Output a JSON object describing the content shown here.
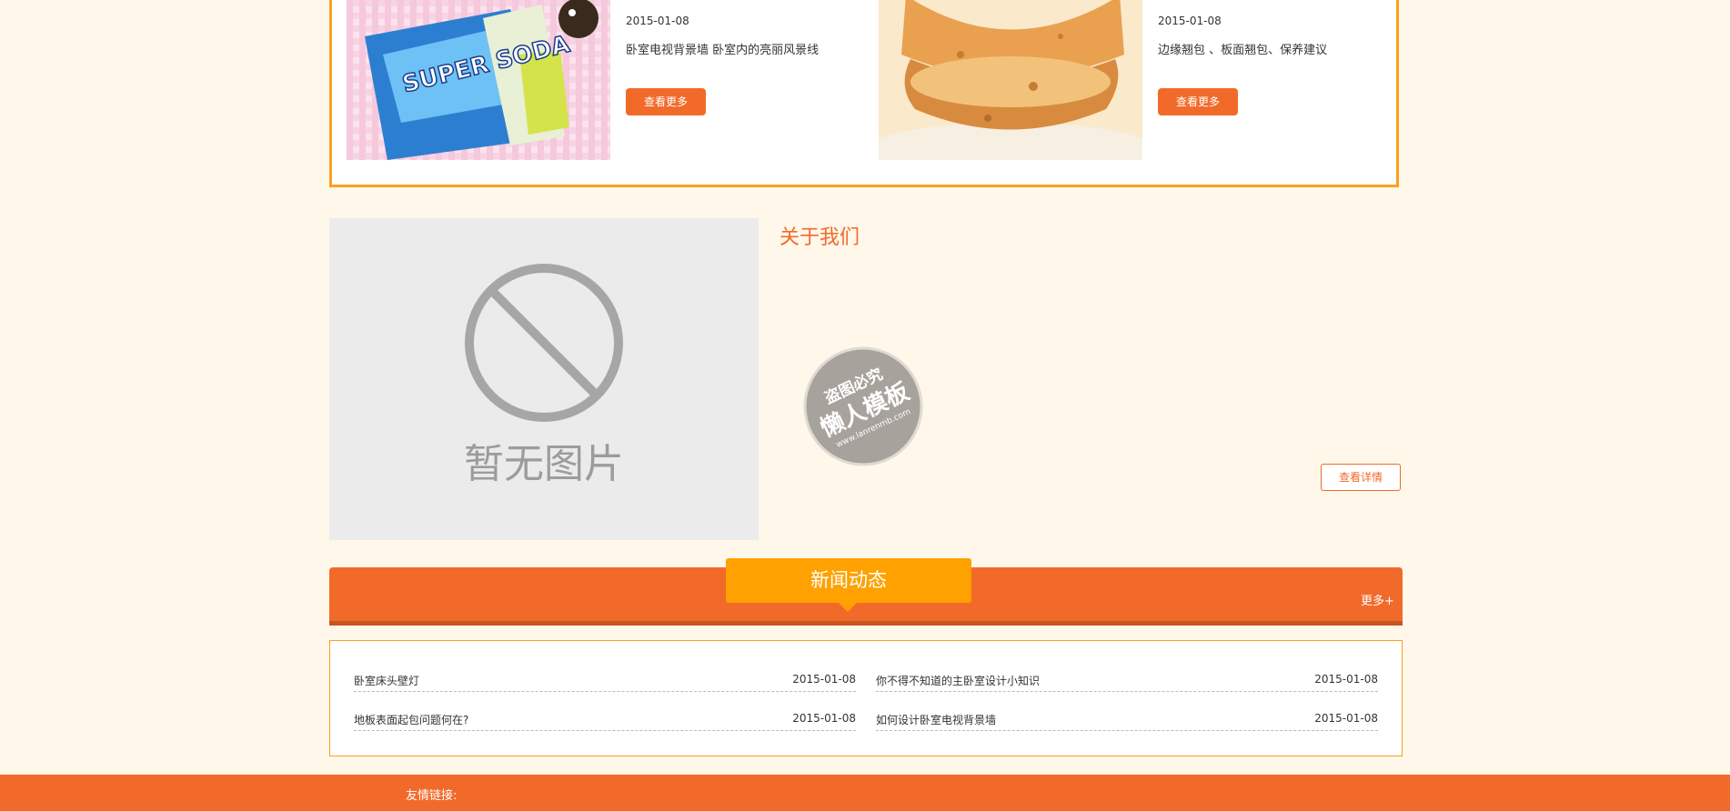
{
  "products": [
    {
      "date": "2015-01-08",
      "title": "卧室电视背景墙 卧室内的亮丽风景线",
      "button": "查看更多",
      "image_icon": "snack-bag-image",
      "image_text": "SUPER SODA"
    },
    {
      "date": "2015-01-08",
      "title": "边缘翘包 、板面翘包、保养建议",
      "button": "查看更多",
      "image_icon": "pastry-image"
    }
  ],
  "about": {
    "title": "关于我们",
    "placeholder_text": "暂无图片",
    "button": "查看详情",
    "watermark": {
      "line1": "盗图必究",
      "line2": "懒人模板",
      "line3": "www.lanrenmb.com"
    }
  },
  "news": {
    "title": "新闻动态",
    "more": "更多+",
    "items": [
      {
        "title": "卧室床头壁灯",
        "date": "2015-01-08"
      },
      {
        "title": "你不得不知道的主卧室设计小知识",
        "date": "2015-01-08"
      },
      {
        "title": "地板表面起包问题何在?",
        "date": "2015-01-08"
      },
      {
        "title": "如何设计卧室电视背景墙",
        "date": "2015-01-08"
      }
    ]
  },
  "footer": {
    "links_label": "友情链接:"
  },
  "colors": {
    "accent": "#f26a2a",
    "tab": "#ffa100",
    "border": "#f8a11c",
    "background": "#fef7ea"
  }
}
